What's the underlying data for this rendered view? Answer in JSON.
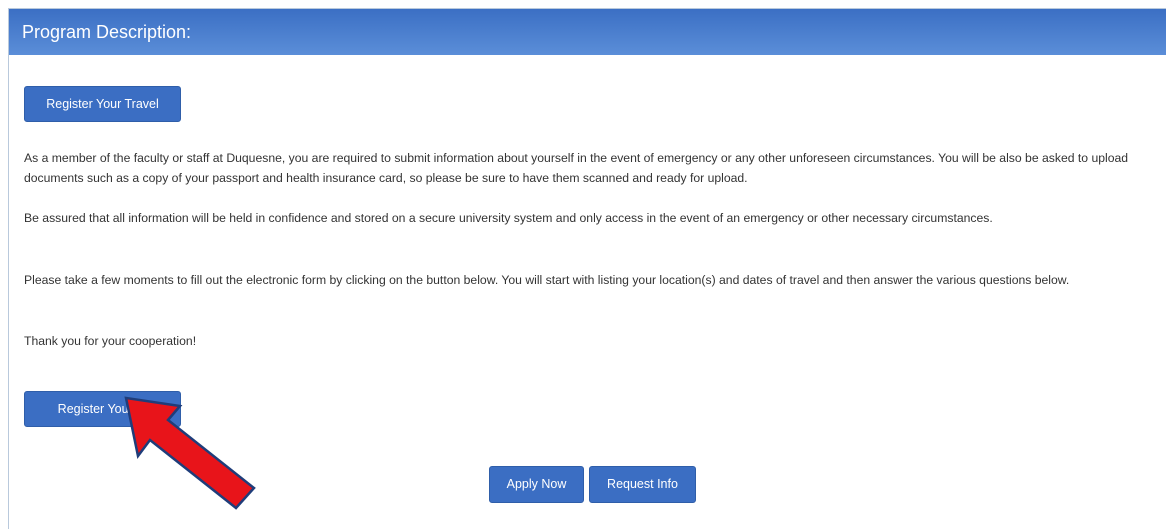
{
  "panel": {
    "title": "Program Description:"
  },
  "buttons": {
    "register_top": "Register Your Travel",
    "register_bottom": "Register Your Tr",
    "apply_now": "Apply Now",
    "request_info": "Request Info"
  },
  "paragraphs": [
    "As a member of the faculty or staff at Duquesne, you are required to submit information about yourself in the event of emergency or any other unforeseen circumstances.  You will be also be asked to upload documents such as a copy of your passport and health insurance card, so please be sure to have them scanned and ready for upload.",
    "Be assured that all information will be held in confidence and stored on a secure university system and only access in the event of an emergency or other necessary circumstances.",
    "Please take a few moments to fill out the electronic form by clicking on the button below.  You will start with listing your location(s) and dates of travel and then answer the various questions below.",
    "Thank you for your cooperation!"
  ],
  "annotation": {
    "icon": "red-arrow-icon",
    "fill_color": "#e8141a",
    "stroke_color": "#1f3d7a"
  },
  "colors": {
    "header_gradient_top": "#3b6fc4",
    "header_gradient_bottom": "#5b8ed8",
    "button": "#3b6ec3",
    "text": "#333333"
  }
}
